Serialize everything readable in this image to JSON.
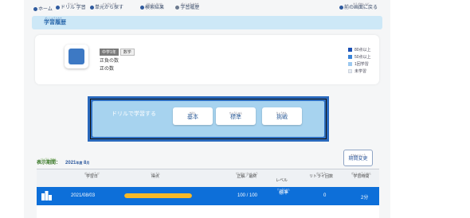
{
  "nav": {
    "items": [
      {
        "label": "ホーム",
        "ruby": ""
      },
      {
        "label": "学習",
        "ruby": "がくしゅう",
        "prefix": "ドリル",
        "prefix_ruby": ""
      },
      {
        "label": "単元から探す",
        "ruby": "たんげん さが"
      },
      {
        "label": "検索結果",
        "ruby": "けんさく けっか"
      },
      {
        "label": "学習履歴",
        "ruby": "がくしゅう りれき"
      }
    ],
    "right": {
      "label": "前の画面に戻る",
      "ruby": "まえ がめん もど"
    }
  },
  "title_bar": {
    "label": "学習履歴",
    "ruby": "がくしゅうりれき"
  },
  "unit": {
    "grade": "中学1年",
    "subject": "数学",
    "line1": "正負の数",
    "line2": "正の数",
    "icon": "unit-square-icon"
  },
  "legend": [
    {
      "label": "80点以上",
      "color": "#1a4fb4"
    },
    {
      "label": "50点以上",
      "color": "#3a84d8"
    },
    {
      "label": "1回学習",
      "color": "#9cc8ef"
    },
    {
      "label": "未学習",
      "color": "#e6ebf1"
    }
  ],
  "drill": {
    "label": "ドリルで学習する",
    "label_ruby": "がくしゅう",
    "buttons": [
      {
        "label": "基本",
        "ruby": "きほん"
      },
      {
        "label": "標準",
        "ruby": "ひょうじゅん"
      },
      {
        "label": "挑戦",
        "ruby": "ちょうせん"
      }
    ]
  },
  "period": {
    "label": "表示期間：",
    "ruby": "ひょうじ きかん",
    "year": "2021",
    "year_unit": "年度",
    "month": "8",
    "month_unit": "月"
  },
  "period_change": {
    "label": "期間変更",
    "ruby": "きかんへんこう"
  },
  "table": {
    "headers": [
      {
        "label": "学習日",
        "ruby": "がくしゅう び"
      },
      {
        "label": "得点",
        "ruby": "とくてん"
      },
      {
        "label": "正解／最終",
        "ruby": "せいかい さいしゅう"
      },
      {
        "label": "レベル",
        "ruby": ""
      },
      {
        "label": "リトライ回数",
        "ruby": "かいすう"
      },
      {
        "label": "学習時間",
        "ruby": "がくしゅう じかん"
      }
    ],
    "rows": [
      {
        "date": "2021/08/03",
        "score_fraction": 1.0,
        "correct": "100 / 100",
        "level": "標準",
        "level_ruby": "ひょうじゅん",
        "retries": "0",
        "time": "2分"
      }
    ]
  },
  "colors": {
    "accent": "#0d6fd9",
    "title_bar": "#cde8f7",
    "drill_panel": "#a7d3ef",
    "score_bar": "#f7b928"
  }
}
